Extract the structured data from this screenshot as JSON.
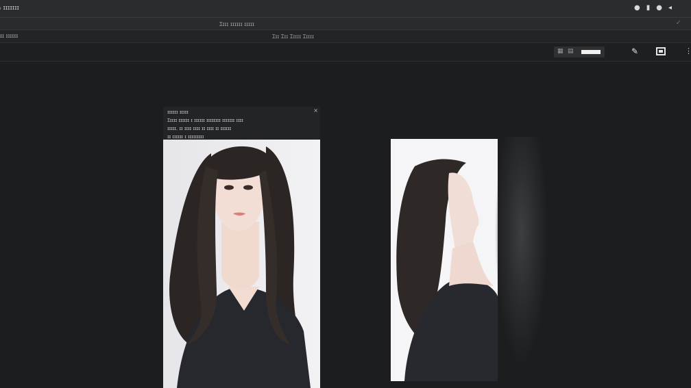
{
  "topbar": {
    "menu_label": "ᵢ ɪɪɪɪɪɪɪ",
    "icons": [
      "settings-icon",
      "info-icon",
      "bell-icon",
      "back-icon"
    ],
    "icon_glyphs": [
      "●",
      "▮",
      "●",
      "◂"
    ]
  },
  "tabbar": {
    "title": "Ɪɪɪɪ ɪɪɪɪɪɪ ɪɪɪɪɪ"
  },
  "subbar": {
    "left_label": "ɪɪ ɪɪɪɪɪɪ",
    "center_label": "Ɪɪɪ Ɪɪɪ Ɪɪɪɪɪ Ɪɪɪɪɪ"
  },
  "toolbar": {
    "pen_glyph": "✎",
    "more_glyph": "⋮"
  },
  "info_panel": {
    "rows": [
      "ɪɪɪɪɪɪ ɪɪɪɪɪ",
      "Ɪɪɪɪɪ ɪɪɪɪɪɪ ɪ ɪɪɪɪɪɪ ɪɪɪɪɪɪɪɪ ɪɪɪɪɪɪɪ ɪɪɪɪ",
      "ɪɪɪɪɪ. ɪɪ ɪɪɪɪ ɪɪɪɪ ɪɪ ɪɪɪɪ ɪɪ ɪɪɪɪɪɪ",
      "ɪɪ ɪɪɪɪɪɪ ɪ ɪɪɪɪɪɪɪɪɪ"
    ],
    "close_glyph": "×"
  },
  "colors": {
    "background": "#1c1d1e",
    "hair": "#2a2624",
    "sweater": "#26262d",
    "skin": "#f0d9cf"
  }
}
